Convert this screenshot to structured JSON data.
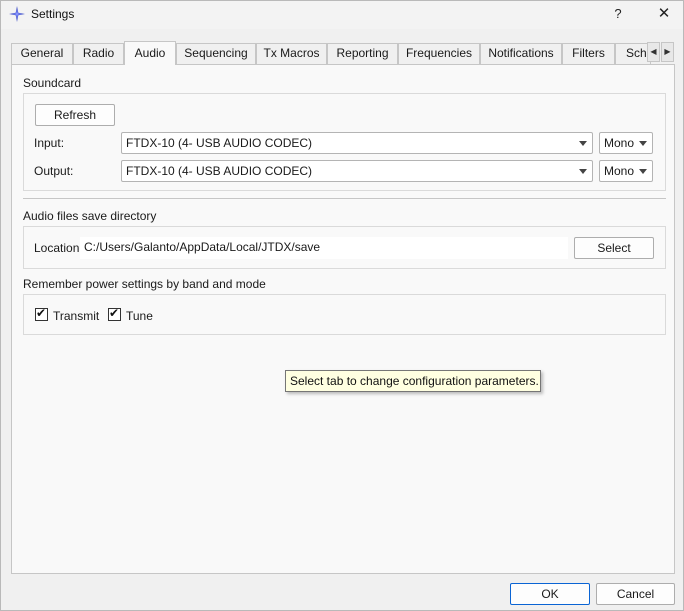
{
  "window": {
    "title": "Settings",
    "icon": "star-compass-icon",
    "help_label": "?",
    "close_label": "✕"
  },
  "tabs": [
    {
      "label": "General"
    },
    {
      "label": "Radio"
    },
    {
      "label": "Audio",
      "active": true
    },
    {
      "label": "Sequencing"
    },
    {
      "label": "Tx Macros"
    },
    {
      "label": "Reporting"
    },
    {
      "label": "Frequencies"
    },
    {
      "label": "Notifications"
    },
    {
      "label": "Filters"
    },
    {
      "label": "Sch"
    }
  ],
  "tab_scroll": {
    "left_label": "◀",
    "right_label": "▶"
  },
  "soundcard": {
    "title": "Soundcard",
    "refresh_label": "Refresh",
    "input_label": "Input:",
    "input_value": "FTDX-10 (4- USB AUDIO  CODEC)",
    "input_channel": "Mono",
    "output_label": "Output:",
    "output_value": "FTDX-10 (4- USB AUDIO  CODEC)",
    "output_channel": "Mono"
  },
  "audio_files": {
    "title": "Audio files save directory",
    "location_label": "Location:",
    "location_value": "C:/Users/Galanto/AppData/Local/JTDX/save",
    "select_label": "Select"
  },
  "power": {
    "title": "Remember power settings by band and mode",
    "transmit_label": "Transmit",
    "transmit_checked": true,
    "tune_label": "Tune",
    "tune_checked": true
  },
  "tooltip": "Select tab to change configuration parameters.",
  "footer": {
    "ok_label": "OK",
    "cancel_label": "Cancel"
  },
  "colors": {
    "accent": "#0a64d4",
    "tooltip_bg": "#ffffe1",
    "window_bg": "#f0f0f0",
    "pane_bg": "#f9f9f9"
  }
}
